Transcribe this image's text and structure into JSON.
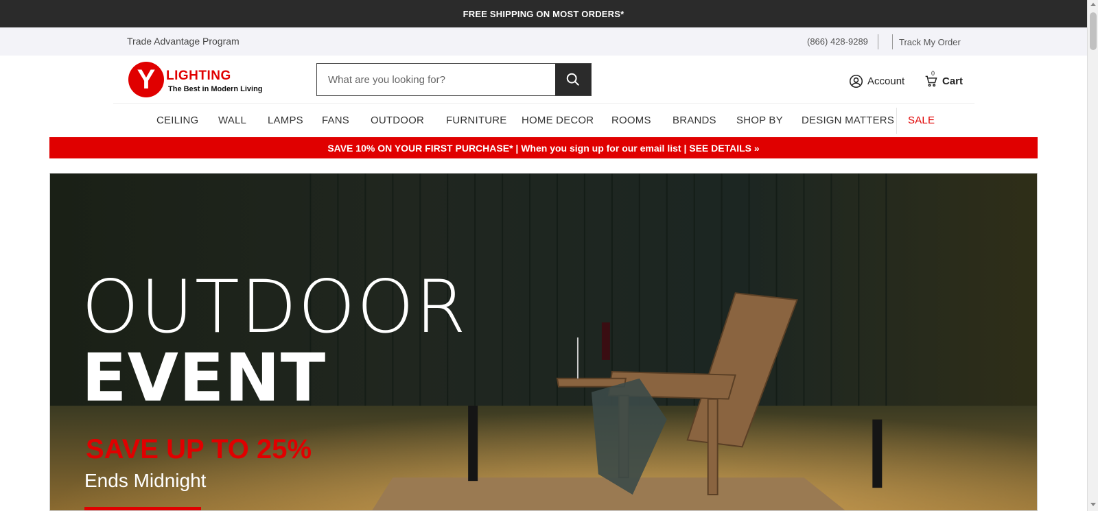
{
  "announcement": {
    "text": "FREE SHIPPING ON MOST ORDERS*"
  },
  "utility": {
    "trade_program": "Trade Advantage Program",
    "phone": "(866) 428-9289",
    "track_order": "Track My Order"
  },
  "logo": {
    "letter": "Y",
    "word": "LIGHTING",
    "tagline": "The Best in Modern Living"
  },
  "search": {
    "placeholder": "What are you looking for?",
    "icon": "search-icon"
  },
  "account": {
    "label": "Account",
    "icon": "user-circle-icon"
  },
  "cart": {
    "label": "Cart",
    "count": "0",
    "icon": "cart-icon"
  },
  "nav": {
    "items": [
      "CEILING",
      "WALL",
      "LAMPS",
      "FANS",
      "OUTDOOR",
      "FURNITURE",
      "HOME DECOR",
      "ROOMS",
      "BRANDS",
      "SHOP BY",
      "DESIGN MATTERS",
      "SALE"
    ]
  },
  "promo": {
    "text": "SAVE 10% ON YOUR FIRST PURCHASE* | When you sign up for our email list | SEE DETAILS »"
  },
  "hero": {
    "title_line1": "OUTDOOR",
    "title_line2": "EVENT",
    "save_text": "SAVE UP TO 25%",
    "ends_text": "Ends Midnight"
  },
  "colors": {
    "brand_red": "#e00000",
    "dark_bar": "#2b2b2b",
    "utility_bg": "#f3f3f8"
  }
}
